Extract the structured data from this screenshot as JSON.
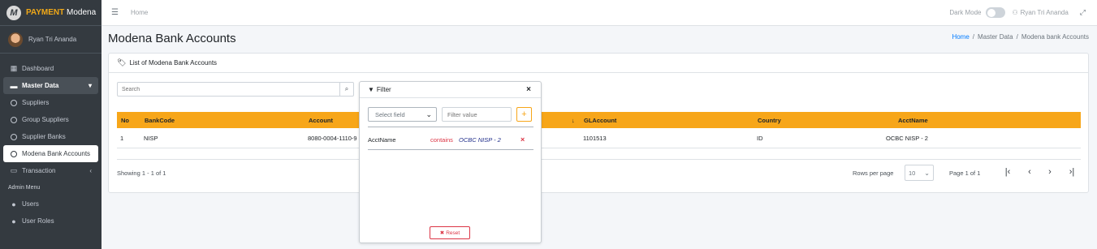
{
  "brand": {
    "logo_letter": "M",
    "name_bold": "PAYMENT",
    "name_rest": "Modena"
  },
  "user": {
    "name": "Ryan Tri Ananda"
  },
  "sidebar": {
    "items": [
      {
        "label": "Dashboard",
        "icon": "grid-icon"
      },
      {
        "label": "Master Data",
        "icon": "drive-icon"
      },
      {
        "label": "Suppliers",
        "icon": "circle-icon"
      },
      {
        "label": "Group Suppliers",
        "icon": "circle-icon"
      },
      {
        "label": "Supplier Banks",
        "icon": "circle-icon"
      },
      {
        "label": "Modena Bank Accounts",
        "icon": "circle-icon"
      },
      {
        "label": "Transaction",
        "icon": "id-card-icon"
      },
      {
        "label": "Users",
        "icon": "user-icon"
      },
      {
        "label": "User Roles",
        "icon": "user-gear-icon"
      }
    ],
    "header_admin": "Admin Menu"
  },
  "topbar": {
    "home": "Home",
    "dark_mode": "Dark Mode",
    "user": "Ryan Tri Ananda"
  },
  "page": {
    "title": "Modena Bank Accounts",
    "breadcrumb": [
      "Home",
      "/",
      "Master Data",
      "/",
      "Modena bank Accounts"
    ]
  },
  "card": {
    "title": "List of Modena Bank Accounts",
    "search_placeholder": "Search",
    "columns": [
      "No",
      "BankCode",
      "Account",
      "GLAccount",
      "Country",
      "AcctName"
    ],
    "sort_indicator": "↓",
    "rows": [
      {
        "no": "1",
        "bankcode": "NISP",
        "account": "8080-0004-1110-9",
        "glaccount": "1101513",
        "country": "ID",
        "acctname": "OCBC NISP - 2"
      }
    ],
    "showing": "Showing 1 - 1 of 1",
    "rows_per_page_label": "Rows per page",
    "rows_per_page_value": "10",
    "page_info": "Page 1 of 1"
  },
  "filter": {
    "title": "Filter",
    "field_placeholder": "Select field",
    "value_placeholder": "Filter value",
    "rule": {
      "field": "AcctName",
      "operator": "contains",
      "value": "OCBC NISP - 2"
    },
    "reset_label": "Reset"
  },
  "colors": {
    "accent": "#f7a619",
    "sidebar": "#343a40",
    "danger": "#dc3545"
  }
}
